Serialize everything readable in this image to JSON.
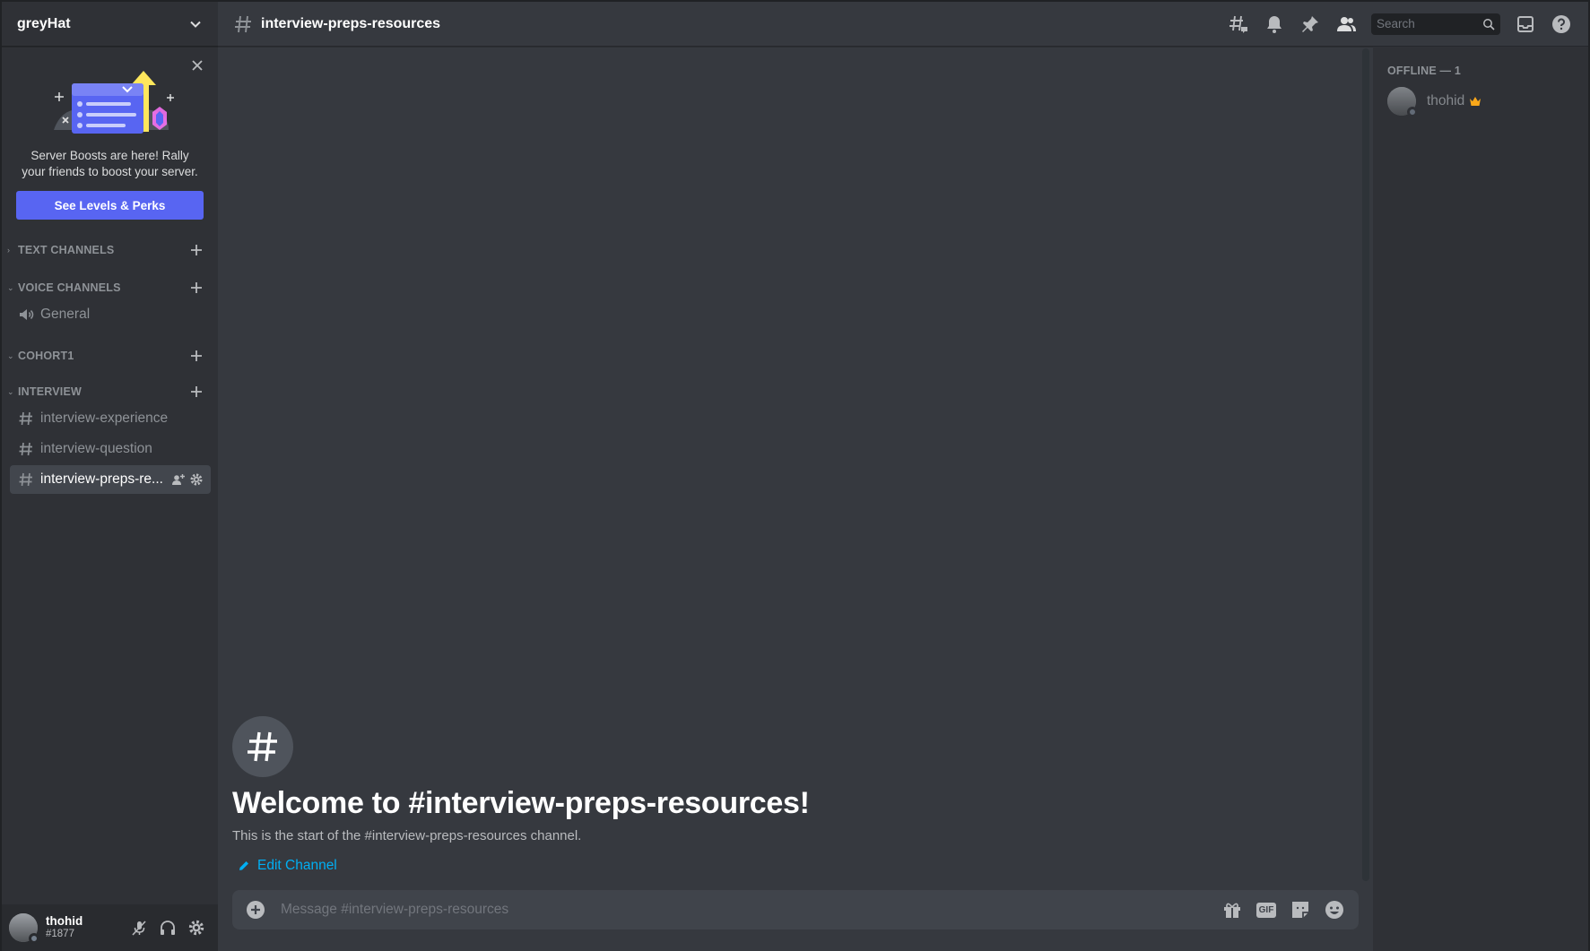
{
  "server": {
    "name": "greyHat"
  },
  "boost": {
    "text": "Server Boosts are here! Rally your friends to boost your server.",
    "button_label": "See Levels & Perks"
  },
  "categories": [
    {
      "label": "TEXT CHANNELS"
    },
    {
      "label": "VOICE CHANNELS",
      "channels": [
        {
          "name": "General",
          "type": "voice"
        }
      ]
    },
    {
      "label": "COHORT1"
    },
    {
      "label": "INTERVIEW",
      "channels": [
        {
          "name": "interview-experience",
          "type": "text"
        },
        {
          "name": "interview-question",
          "type": "text"
        },
        {
          "name": "interview-preps-re...",
          "type": "text",
          "active": true
        }
      ]
    }
  ],
  "user": {
    "name": "thohid",
    "tag": "#1877"
  },
  "header": {
    "channel": "interview-preps-resources",
    "search_placeholder": "Search"
  },
  "members": {
    "heading": "OFFLINE — 1",
    "list": [
      {
        "name": "thohid",
        "owner": true
      }
    ]
  },
  "welcome": {
    "title": "Welcome to #interview-preps-resources!",
    "subtitle": "This is the start of the #interview-preps-resources channel.",
    "edit_label": "Edit Channel"
  },
  "composer": {
    "placeholder": "Message #interview-preps-resources",
    "gif_label": "GIF"
  },
  "colors": {
    "accent": "#5865f2",
    "link": "#00aff4",
    "crown": "#faa81a"
  }
}
